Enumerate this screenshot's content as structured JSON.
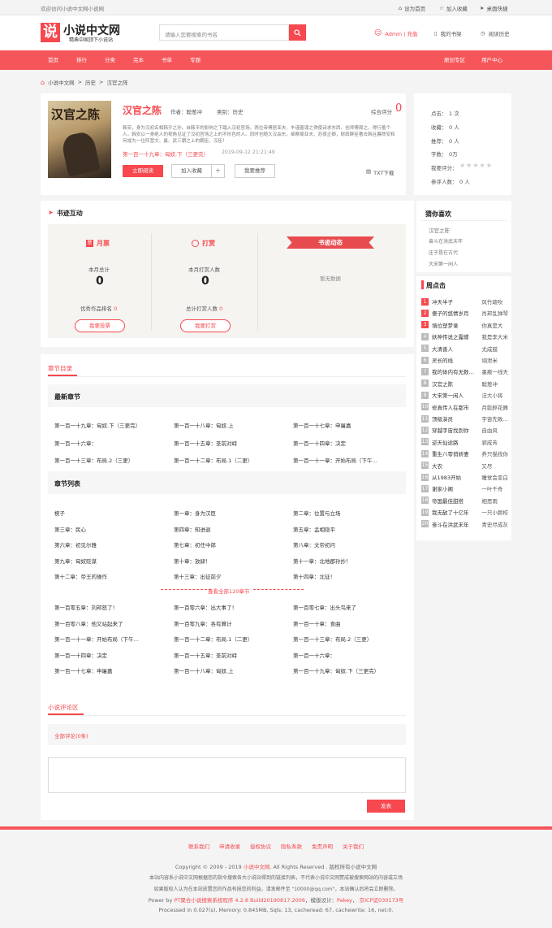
{
  "topbar": {
    "welcome": "欢迎访问小说中文网小说网",
    "home": "设为首页",
    "fav": "加入收藏",
    "desktop": "桌面快捷"
  },
  "header": {
    "logo_char": "说",
    "site_name": "小说中文网",
    "slogan": "精典中国顶下小说站",
    "search_placeholder": "请输入您要搜索的书名",
    "user": "Admin | 充值",
    "bookshelf": "我的书架",
    "history": "阅读历史"
  },
  "nav": {
    "items": [
      "首页",
      "排行",
      "分类",
      "完本",
      "书单",
      "专题"
    ],
    "right": [
      "原创专区",
      "用户中心"
    ]
  },
  "breadcrumb": [
    "小说中文网",
    "历史",
    "汉官之阵"
  ],
  "book": {
    "title": "汉官之陈",
    "author_label": "作者：",
    "author": "聪葱冲",
    "cat_label": "类别：",
    "category": "历史",
    "score_label": "综合评分",
    "score": "0",
    "cover_text": "汉官之陈",
    "desc": "韩安，身为汉初名相韩平之孙。自韩平的影响之下踏入汉初官场。两位帝傅居亚夫、丰谨善谋之得使诗求东西，创师傅周之，得行善个人。韩安以一身绝人的视角见证了汉初官场之上的不形色的人。同时也随大汉由东。细察周亚夫、苏夜正卿，财政群臣著去韩且暮除安和何成为一位阵营文、最、武三朝之上的朝臣，汉臣！",
    "latest": "第一百一十九章：匈奴.下（三更完）",
    "latest_date": "2019-09-12 21:21:49",
    "read_btn": "立即阅读",
    "shelf_btn": "加入收藏",
    "plus": "＋",
    "recommend_btn": "我要推荐",
    "txt": "TXT下载"
  },
  "book_stats": {
    "clicks_label": "点击：",
    "clicks": "1 次",
    "fav_label": "收藏：",
    "fav": "0 人",
    "rec_label": "推荐：",
    "rec": "0 人",
    "words_label": "字数：",
    "words": "0万",
    "rate_label": "我要评分：",
    "raters_label": "参评人数：",
    "raters": "0 人"
  },
  "interaction": {
    "title": "书迹互动",
    "monthly": "月票",
    "month_total_label": "本月总计",
    "month_total": "0",
    "month_rank_label": "优秀作品排名",
    "month_rank": "0",
    "vote_btn": "我要投票",
    "reward": "打赏",
    "reward_month_label": "本月打赏人数",
    "reward_month": "0",
    "reward_total_label": "总计打赏人数",
    "reward_total": "0",
    "reward_btn": "我要打赏",
    "dynamic": "书迹动态",
    "no_data": "暂无数据"
  },
  "guess": {
    "title": "猜你喜欢",
    "items": [
      "汉官之陈",
      "奋斗在洪武末年",
      "庄子是在古代",
      "大宋第一闲人"
    ]
  },
  "weekly": {
    "title": "周点击",
    "rows": [
      {
        "n": "1",
        "name": "冲天半子",
        "author": "风竹疏吹"
      },
      {
        "n": "2",
        "name": "傻子的悠情岁月",
        "author": "肖邦乱弹琴"
      },
      {
        "n": "3",
        "name": "填位塑梦录",
        "author": "你真是大"
      },
      {
        "n": "4",
        "name": "妖神传说之露蝶",
        "author": "我是李大米"
      },
      {
        "n": "5",
        "name": "大清善人",
        "author": "尤咸鼓"
      },
      {
        "n": "6",
        "name": "灵长的线",
        "author": "翊泄米"
      },
      {
        "n": "7",
        "name": "我的体内有无数…",
        "author": "墨痕一线天"
      },
      {
        "n": "8",
        "name": "汉官之陈",
        "author": "聪葱冲"
      },
      {
        "n": "9",
        "name": "大宋第一闲人",
        "author": "法大小将"
      },
      {
        "n": "10",
        "name": "修真传人在都市",
        "author": "月影醉花舞"
      },
      {
        "n": "11",
        "name": "顶级演员",
        "author": "宇宙先致…"
      },
      {
        "n": "12",
        "name": "穿越字宙找到你",
        "author": "自由风"
      },
      {
        "n": "13",
        "name": "逆天仙途路",
        "author": "郭成芳"
      },
      {
        "n": "14",
        "name": "重生八零俏娇妻",
        "author": "养只猫找你"
      },
      {
        "n": "15",
        "name": "大农",
        "author": "又尽"
      },
      {
        "n": "16",
        "name": "从1983开始",
        "author": "睡觉会变白"
      },
      {
        "n": "17",
        "name": "谢家小阁",
        "author": "一叶千舟"
      },
      {
        "n": "18",
        "name": "帝国最佳甜搭",
        "author": "相思雨"
      },
      {
        "n": "19",
        "name": "我无敌了十亿年",
        "author": "一只小颜校"
      },
      {
        "n": "20",
        "name": "奋斗在洪武末年",
        "author": "青史尽成灰"
      }
    ]
  },
  "catalog": {
    "tab": "章节目录",
    "latest_title": "最新章节",
    "latest": [
      "第一百一十九章：匈奴.下（三更完）",
      "第一百一十八章：匈奴.上",
      "第一百一十七章：申屠嘉",
      "第一百一十六章：",
      "第一百一十五章：圣前对峙",
      "第一百一十四章：决定",
      "第一百一十三章：布局.2（三更）",
      "第一百一十二章：布局.1（二更）",
      "第一百一十一章：开始布局（下午…"
    ],
    "list_title": "章节列表",
    "list1": [
      "楔子",
      "第一章：身为汉臣",
      "第二章：位置与立场",
      "第三章：民心",
      "第四章：知进退",
      "第五章：孟相隐平",
      "第六章：初见尔雅",
      "第七章：初任中郎",
      "第八章：文帝初问",
      "第九章：匈奴贬谋",
      "第十章：放肆！",
      "第十一章：北地郡孙抄！",
      "第十二章：帝王的操作",
      "第十三章：出征前夕",
      "第十四章：北征！"
    ],
    "view_all": "查看全部120章节",
    "list2": [
      "第一百零五章：刘邦怒了！",
      "第一百零六章：出大事了！",
      "第一百零七章：出头鸟来了",
      "第一百零八章：他又站起来了",
      "第一百零九章：各有算计",
      "第一百一十章：食曲",
      "第一百一十一章：开始布局（下午…",
      "第一百一十二章：布局.1（二更）",
      "第一百一十三章：布局.2（三更）",
      "第一百一十四章：决定",
      "第一百一十五章：圣前对峙",
      "第一百一十六章：",
      "第一百一十七章：申屠嘉",
      "第一百一十八章：匈奴.上",
      "第一百一十九章：匈奴.下（三更完）"
    ]
  },
  "comments": {
    "tab": "小说评论区",
    "all": "全部评论(0条)",
    "submit": "发表"
  },
  "footer": {
    "links": [
      "联系我们",
      "申请收录",
      "授权协议",
      "隐私条款",
      "免责声明",
      "关于我们"
    ],
    "copyright_pre": "Copyright © 2009 - 2019 ",
    "copyright_site": "小说中文网",
    "copyright_post": ". All Rights Reserved . 版权所有小说中文网",
    "line2": "本站内容系小说中文网根据您的指令搜索各大小说站得到的链接列表，不代表小说中文网赞成被搜索网站的内容或立场",
    "line3": "如果版权人认为在本站放置您的作品有损您的利益，请发邮件至 \"10000@qq.com\"，本站确认后将会立即删除。",
    "power_pre": "Power by ",
    "power_link": "PT聚合小说搜索系统程序 4.2.8 Build20190817.2006",
    "power_mid": "，模版设计：",
    "designer": "Pakey",
    "icp": "京ICP证030173号",
    "processed": "Processed in 0.027(s), Memory: 0.845MB, Sqls: 13, cacheread: 67, cachewrite: 16, net:0."
  },
  "colors": {
    "accent": "#f6484e",
    "nav": "#f6565a"
  }
}
